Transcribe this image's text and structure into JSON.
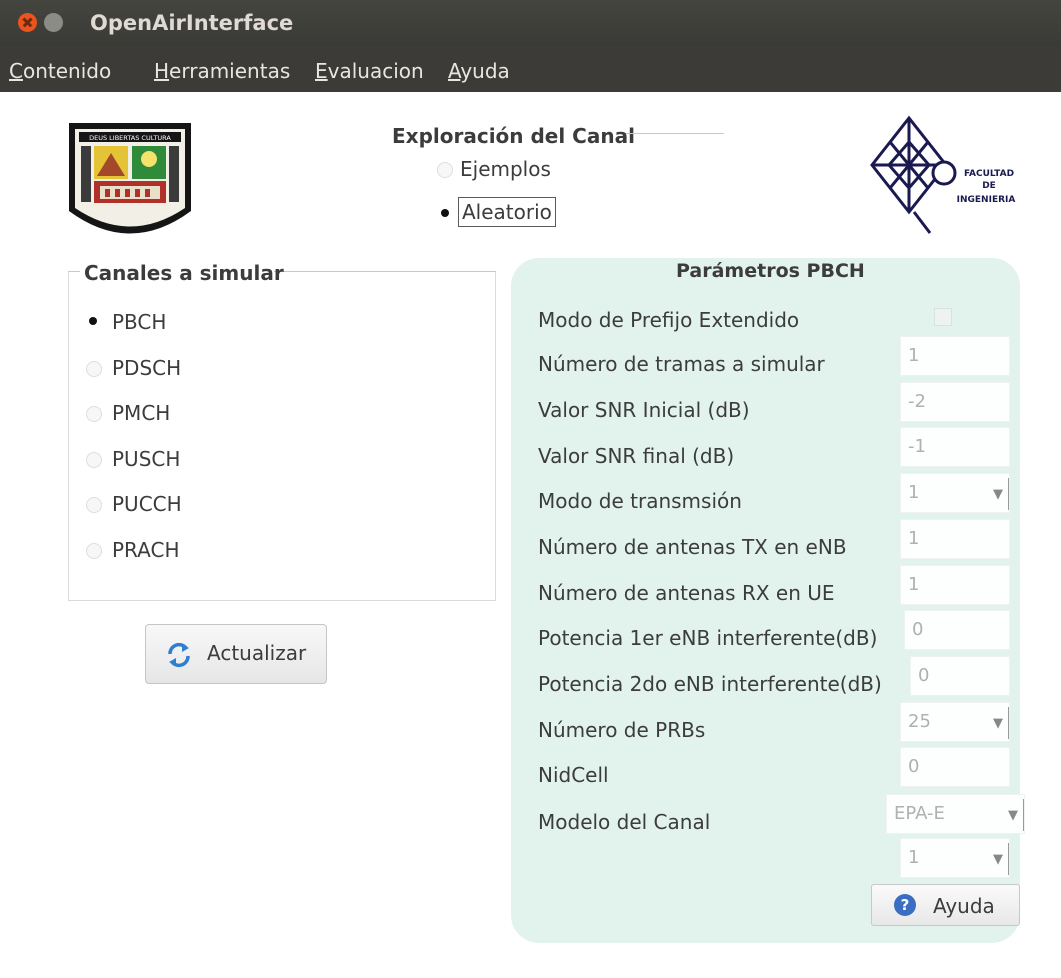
{
  "window": {
    "title": "OpenAirInterface"
  },
  "menu": [
    {
      "mnemonic": "C",
      "rest": "ontenido"
    },
    {
      "mnemonic": "H",
      "rest": "erramientas"
    },
    {
      "mnemonic": "E",
      "rest": "valuacion"
    },
    {
      "mnemonic": "A",
      "rest": "yuda"
    }
  ],
  "exploracion": {
    "title": "Exploración del Canal",
    "options": [
      {
        "label": "Ejemplos",
        "selected": false
      },
      {
        "label": "Aleatorio",
        "selected": true
      }
    ]
  },
  "canales": {
    "title": "Canales a simular",
    "items": [
      {
        "label": "PBCH",
        "selected": true
      },
      {
        "label": "PDSCH",
        "selected": false
      },
      {
        "label": "PMCH",
        "selected": false
      },
      {
        "label": "PUSCH",
        "selected": false
      },
      {
        "label": "PUCCH",
        "selected": false
      },
      {
        "label": "PRACH",
        "selected": false
      }
    ]
  },
  "actualizar_button": "Actualizar",
  "params": {
    "title": "Parámetros PBCH",
    "prefijo_label": "Modo de Prefijo Extendido",
    "prefijo_checked": false,
    "rows": [
      {
        "label": "Número de tramas a simular",
        "value": "1",
        "kind": "text"
      },
      {
        "label": "Valor SNR Inicial (dB)",
        "value": "-2",
        "kind": "text"
      },
      {
        "label": "Valor SNR final (dB)",
        "value": "-1",
        "kind": "text"
      },
      {
        "label": "Modo de transmsión",
        "value": "1",
        "kind": "combo"
      },
      {
        "label": "Número de antenas TX en eNB",
        "value": "1",
        "kind": "text"
      },
      {
        "label": "Número de antenas RX en UE",
        "value": "1",
        "kind": "text"
      },
      {
        "label": "Potencia 1er eNB interferente(dB)",
        "value": "0",
        "kind": "text"
      },
      {
        "label": "Potencia 2do eNB interferente(dB)",
        "value": "0",
        "kind": "text"
      },
      {
        "label": "Número de PRBs",
        "value": "25",
        "kind": "combo"
      },
      {
        "label": "NidCell",
        "value": "0",
        "kind": "text"
      },
      {
        "label": "Modelo del Canal",
        "value": "EPA-E",
        "kind": "combo"
      }
    ],
    "extra_combo_value": "1",
    "help_button": "Ayuda"
  },
  "logos": {
    "left_motto": "DEUS LIBERTAS CULTURA",
    "right_text": [
      "FACULTAD",
      "DE",
      "INGENIERIA"
    ]
  },
  "colors": {
    "titlebar": "#3c3b37",
    "close_button": "#e9541f",
    "panel_background": "#e2f3ee",
    "help_icon": "#3a6ec2",
    "refresh_icon": "#2e7fd0"
  }
}
